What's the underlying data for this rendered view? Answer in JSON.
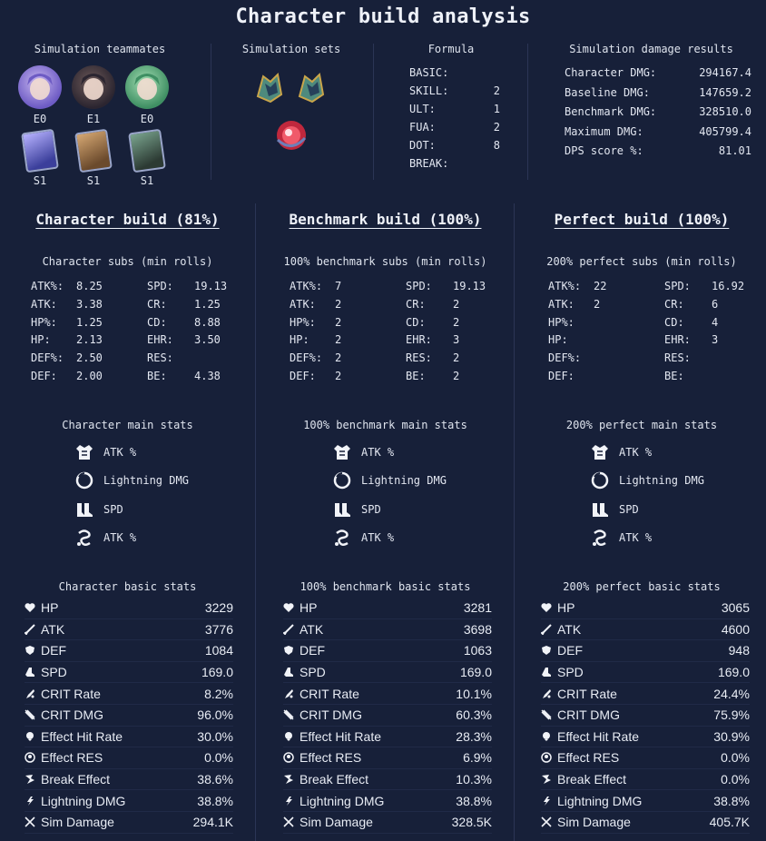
{
  "title": "Character build analysis",
  "teammates": {
    "title": "Simulation teammates",
    "characters": [
      {
        "eidolon": "E0",
        "colors": [
          "#6d5bc4",
          "#c9b8f0"
        ]
      },
      {
        "eidolon": "E1",
        "colors": [
          "#2b2530",
          "#6e5a58"
        ]
      },
      {
        "eidolon": "E0",
        "colors": [
          "#3f8f63",
          "#a5dfb4"
        ]
      }
    ],
    "light_cones": [
      {
        "superimposition": "S1",
        "colors": [
          "#3b3f9b",
          "#b7b2ff"
        ]
      },
      {
        "superimposition": "S1",
        "colors": [
          "#6b4a2c",
          "#d6a873"
        ]
      },
      {
        "superimposition": "S1",
        "colors": [
          "#2c3a33",
          "#7aa58f"
        ]
      }
    ]
  },
  "sets": {
    "title": "Simulation sets",
    "relics": [
      "green-gold-relic-icon",
      "green-gold-relic-icon",
      "red-orb-relic-icon"
    ]
  },
  "formula": {
    "title": "Formula",
    "rows": [
      {
        "label": "BASIC:",
        "value": ""
      },
      {
        "label": "SKILL:",
        "value": "2"
      },
      {
        "label": "ULT:",
        "value": "1"
      },
      {
        "label": "FUA:",
        "value": "2"
      },
      {
        "label": "DOT:",
        "value": "8"
      },
      {
        "label": "BREAK:",
        "value": ""
      }
    ]
  },
  "results": {
    "title": "Simulation damage results",
    "rows": [
      {
        "label": "Character DMG:",
        "value": "294167.4"
      },
      {
        "label": "Baseline DMG:",
        "value": "147659.2"
      },
      {
        "label": "Benchmark DMG:",
        "value": "328510.0"
      },
      {
        "label": "Maximum DMG:",
        "value": "405799.4"
      },
      {
        "label": "DPS score %:",
        "value": "81.01"
      }
    ]
  },
  "builds": [
    {
      "title": "Character build (81%)",
      "subs_title": "Character subs (min rolls)",
      "subs": [
        [
          "ATK%:",
          "8.25",
          "SPD:",
          "19.13"
        ],
        [
          "ATK:",
          "3.38",
          "CR:",
          "1.25"
        ],
        [
          "HP%:",
          "1.25",
          "CD:",
          "8.88"
        ],
        [
          "HP:",
          "2.13",
          "EHR:",
          "3.50"
        ],
        [
          "DEF%:",
          "2.50",
          "RES:",
          ""
        ],
        [
          "DEF:",
          "2.00",
          "BE:",
          "4.38"
        ]
      ],
      "mains_title": "Character main stats",
      "mains": [
        "ATK %",
        "Lightning DMG",
        "SPD",
        "ATK %"
      ],
      "basic_title": "Character basic stats",
      "basic": [
        "3229",
        "3776",
        "1084",
        "169.0",
        "8.2%",
        "96.0%",
        "30.0%",
        "0.0%",
        "38.6%",
        "38.8%",
        "294.1K"
      ]
    },
    {
      "title": "Benchmark build (100%)",
      "subs_title": "100% benchmark subs (min rolls)",
      "subs": [
        [
          "ATK%:",
          "7",
          "SPD:",
          "19.13"
        ],
        [
          "ATK:",
          "2",
          "CR:",
          "2"
        ],
        [
          "HP%:",
          "2",
          "CD:",
          "2"
        ],
        [
          "HP:",
          "2",
          "EHR:",
          "3"
        ],
        [
          "DEF%:",
          "2",
          "RES:",
          "2"
        ],
        [
          "DEF:",
          "2",
          "BE:",
          "2"
        ]
      ],
      "mains_title": "100% benchmark main stats",
      "mains": [
        "ATK %",
        "Lightning DMG",
        "SPD",
        "ATK %"
      ],
      "basic_title": "100% benchmark basic stats",
      "basic": [
        "3281",
        "3698",
        "1063",
        "169.0",
        "10.1%",
        "60.3%",
        "28.3%",
        "6.9%",
        "10.3%",
        "38.8%",
        "328.5K"
      ]
    },
    {
      "title": "Perfect build (100%)",
      "subs_title": "200% perfect subs (min rolls)",
      "subs": [
        [
          "ATK%:",
          "22",
          "SPD:",
          "16.92"
        ],
        [
          "ATK:",
          "2",
          "CR:",
          "6"
        ],
        [
          "HP%:",
          "",
          "CD:",
          "4"
        ],
        [
          "HP:",
          "",
          "EHR:",
          "3"
        ],
        [
          "DEF%:",
          "",
          "RES:",
          ""
        ],
        [
          "DEF:",
          "",
          "BE:",
          ""
        ]
      ],
      "mains_title": "200% perfect main stats",
      "mains": [
        "ATK %",
        "Lightning DMG",
        "SPD",
        "ATK %"
      ],
      "basic_title": "200% perfect basic stats",
      "basic": [
        "3065",
        "4600",
        "948",
        "169.0",
        "24.4%",
        "75.9%",
        "30.9%",
        "0.0%",
        "0.0%",
        "38.8%",
        "405.7K"
      ]
    }
  ],
  "main_stat_icons": [
    "body-armor-icon",
    "orb-ring-icon",
    "boots-icon",
    "rope-icon"
  ],
  "basic_labels": [
    {
      "label": "HP",
      "icon": "heart-icon"
    },
    {
      "label": "ATK",
      "icon": "sword-icon"
    },
    {
      "label": "DEF",
      "icon": "shield-icon"
    },
    {
      "label": "SPD",
      "icon": "speed-boot-icon"
    },
    {
      "label": "CRIT Rate",
      "icon": "crit-rate-icon"
    },
    {
      "label": "CRIT DMG",
      "icon": "crit-dmg-icon"
    },
    {
      "label": "Effect Hit Rate",
      "icon": "effect-hit-icon"
    },
    {
      "label": "Effect RES",
      "icon": "effect-res-icon"
    },
    {
      "label": "Break Effect",
      "icon": "break-icon"
    },
    {
      "label": "Lightning DMG",
      "icon": "lightning-icon"
    },
    {
      "label": "Sim Damage",
      "icon": "crossed-swords-icon"
    }
  ],
  "colors": {
    "background": "#172039",
    "divider": "#2b3555",
    "text": "#e3e7f1"
  }
}
